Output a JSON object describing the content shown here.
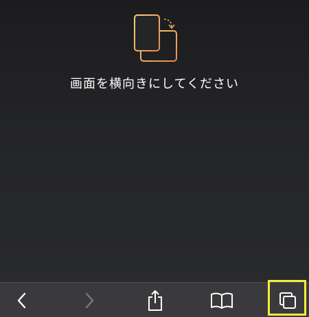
{
  "message": "画面を横向きにしてください",
  "icons": {
    "rotate": "rotate-device-icon",
    "back": "chevron-left-icon",
    "forward": "chevron-right-icon",
    "share": "share-icon",
    "bookmarks": "book-icon",
    "tabs": "tabs-icon"
  },
  "colors": {
    "accent_gradient_start": "#f6d47a",
    "accent_gradient_end": "#e88a4a",
    "toolbar_bg": "#3a3a3c",
    "highlight": "#f4ed3c"
  },
  "toolbar": {
    "forward_enabled": false
  }
}
